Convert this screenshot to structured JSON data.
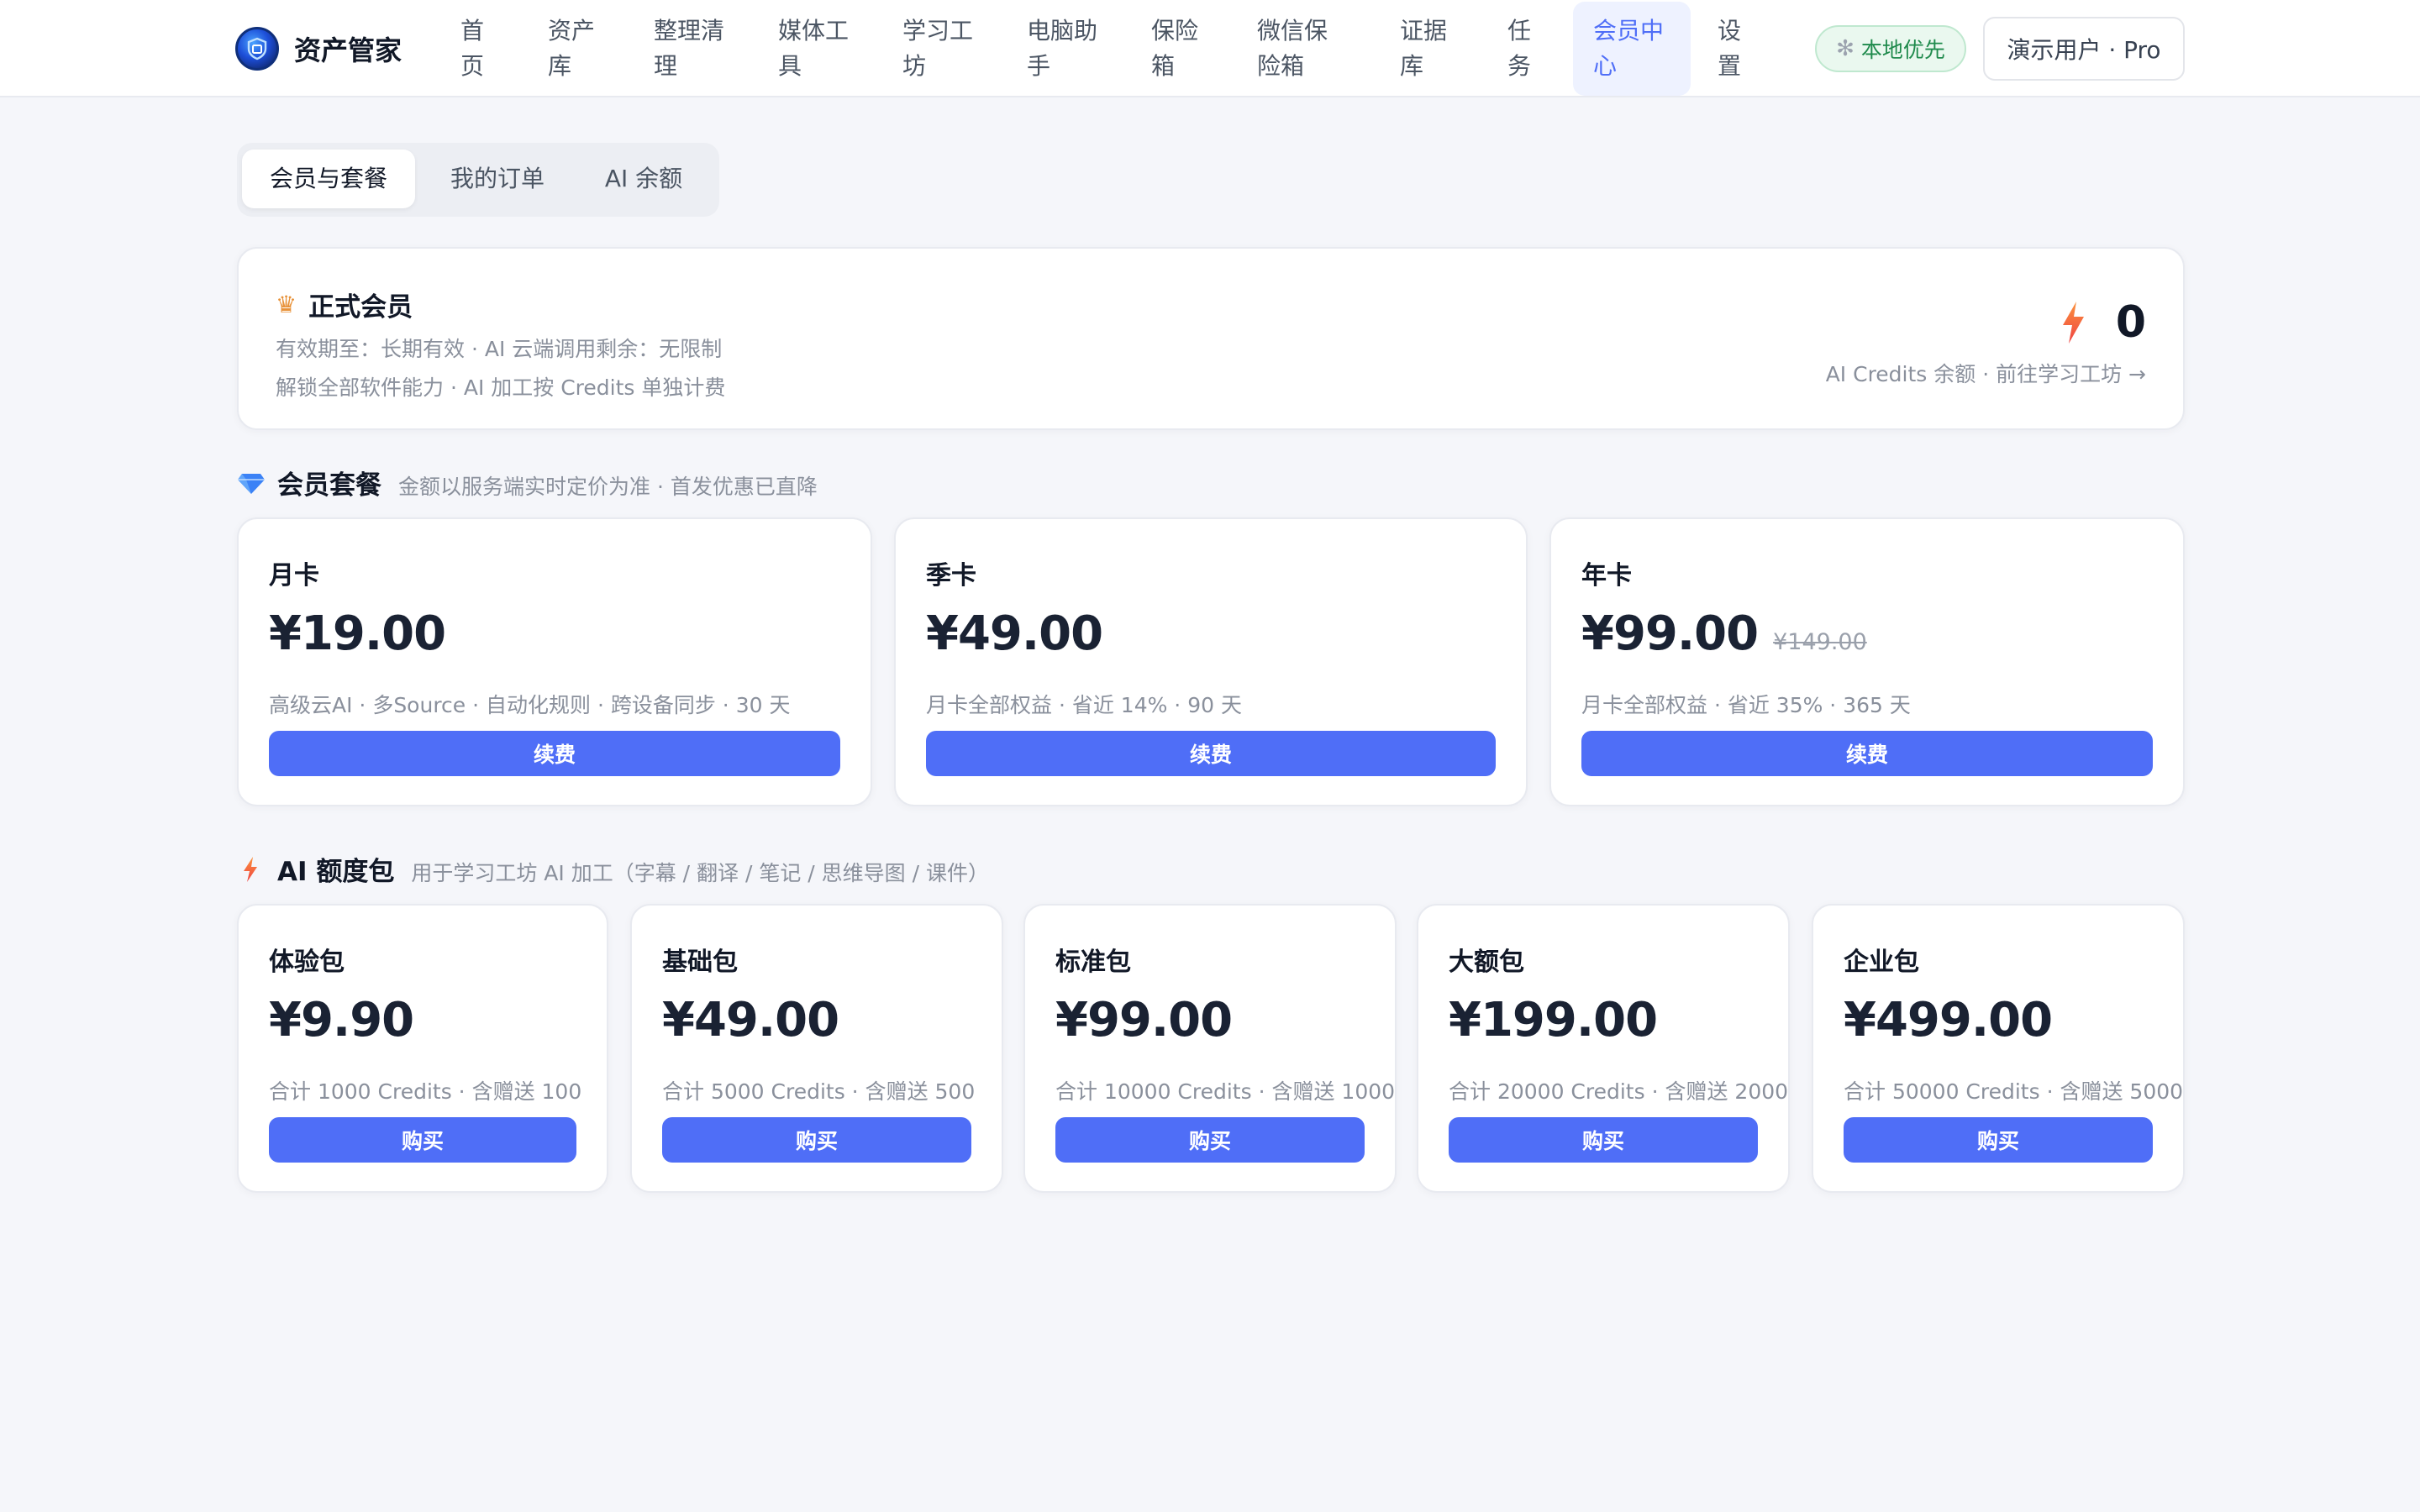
{
  "app": {
    "name": "资产管家"
  },
  "nav": {
    "items": [
      {
        "label": "首页"
      },
      {
        "label": "资产库"
      },
      {
        "label": "整理清理"
      },
      {
        "label": "媒体工具"
      },
      {
        "label": "学习工坊"
      },
      {
        "label": "电脑助手"
      },
      {
        "label": "保险箱"
      },
      {
        "label": "微信保险箱"
      },
      {
        "label": "证据库"
      },
      {
        "label": "任务"
      },
      {
        "label": "会员中心",
        "active": true
      },
      {
        "label": "设置"
      }
    ],
    "local_badge": "本地优先",
    "user": "演示用户 · Pro"
  },
  "tabs": [
    {
      "label": "会员与套餐",
      "active": true
    },
    {
      "label": "我的订单"
    },
    {
      "label": "AI 余额"
    }
  ],
  "membership": {
    "title": "正式会员",
    "line1": "有效期至：长期有效 · AI 云端调用剩余：无限制",
    "line2": "解锁全部软件能力 · AI 加工按 Credits 单独计费",
    "credits_balance": "0",
    "credits_link": "AI Credits 余额 · 前往学习工坊 →"
  },
  "plans_section": {
    "title": "会员套餐",
    "note": "金额以服务端实时定价为准 · 首发优惠已直降",
    "plans": [
      {
        "name": "月卡",
        "price": "¥19.00",
        "old_price": "",
        "desc": "高级云AI · 多Source · 自动化规则 · 跨设备同步 · 30 天",
        "button": "续费"
      },
      {
        "name": "季卡",
        "price": "¥49.00",
        "old_price": "",
        "desc": "月卡全部权益 · 省近 14% · 90 天",
        "button": "续费"
      },
      {
        "name": "年卡",
        "price": "¥99.00",
        "old_price": "¥149.00",
        "desc": "月卡全部权益 · 省近 35% · 365 天",
        "button": "续费"
      }
    ]
  },
  "packs_section": {
    "title": "AI 额度包",
    "note": "用于学习工坊 AI 加工（字幕 / 翻译 / 笔记 / 思维导图 / 课件）",
    "packs": [
      {
        "name": "体验包",
        "price": "¥9.90",
        "desc": "合计 1000 Credits · 含赠送 100",
        "button": "购买"
      },
      {
        "name": "基础包",
        "price": "¥49.00",
        "desc": "合计 5000 Credits · 含赠送 500",
        "button": "购买"
      },
      {
        "name": "标准包",
        "price": "¥99.00",
        "desc": "合计 10000 Credits · 含赠送 1000",
        "button": "购买"
      },
      {
        "name": "大额包",
        "price": "¥199.00",
        "desc": "合计 20000 Credits · 含赠送 2000",
        "button": "购买"
      },
      {
        "name": "企业包",
        "price": "¥499.00",
        "desc": "合计 50000 Credits · 含赠送 5000",
        "button": "购买"
      }
    ]
  },
  "colors": {
    "accent": "#4f6ef7",
    "success": "#1f8a4c",
    "bolt": "#f97316"
  },
  "icons": [
    "brand-logo-icon",
    "gear-icon",
    "crown-icon",
    "bolt-icon",
    "diamond-icon"
  ]
}
